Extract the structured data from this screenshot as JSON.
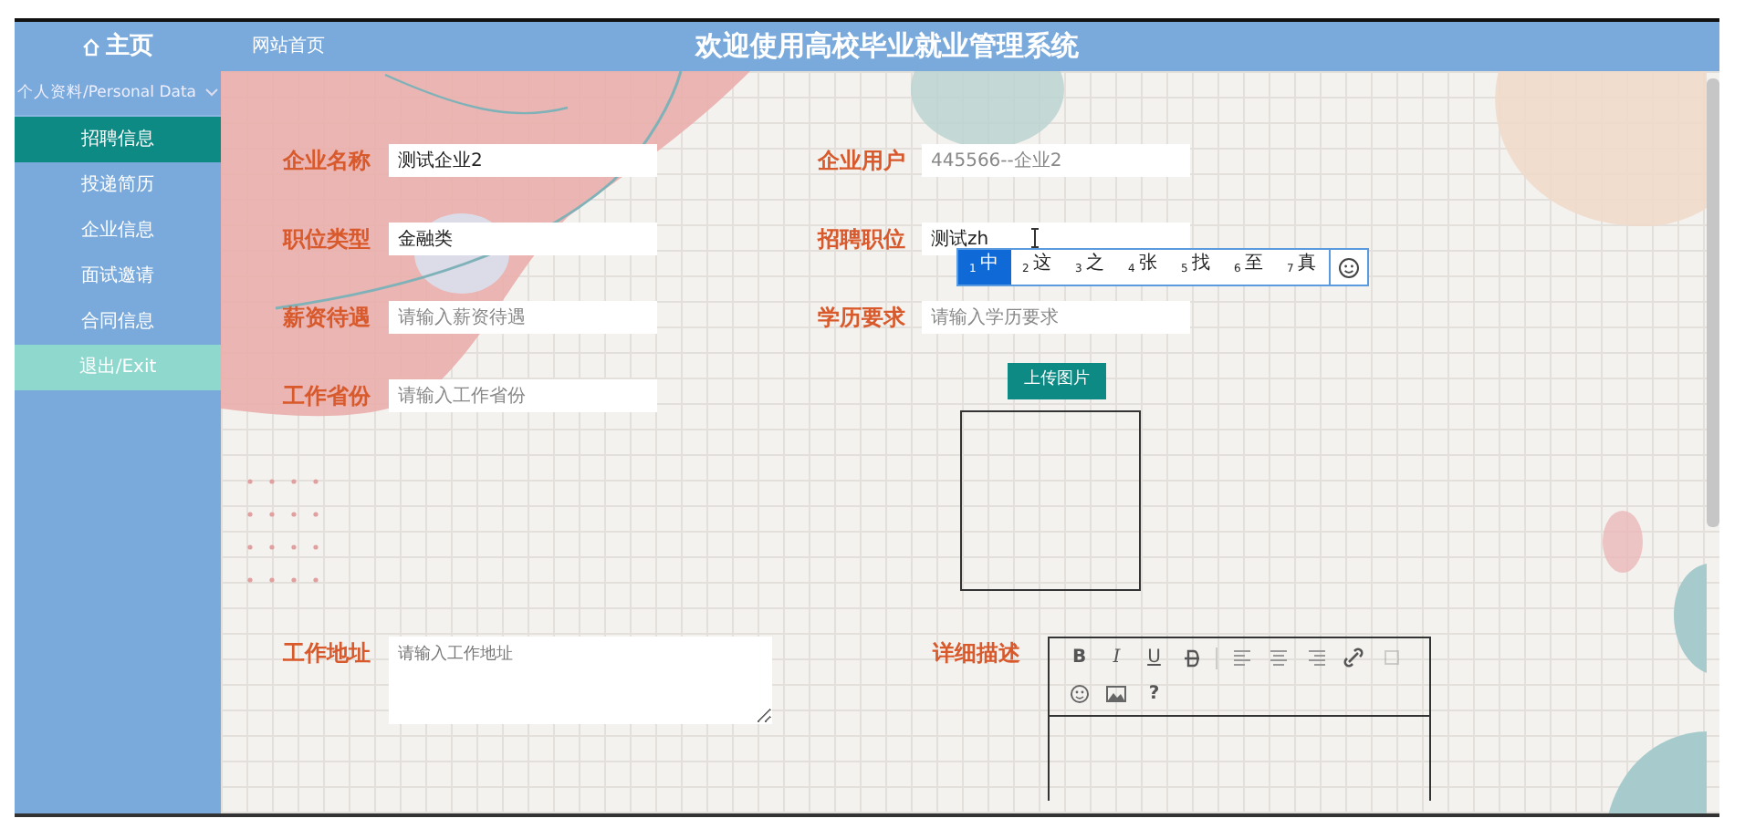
{
  "header": {
    "home": "主页",
    "site_link": "网站首页",
    "title": "欢迎使用高校毕业就业管理系统"
  },
  "sidebar": {
    "group": {
      "label": "个人资料/Personal Data",
      "expanded": true
    },
    "items": [
      {
        "label": "招聘信息",
        "selected": true,
        "kind": "link"
      },
      {
        "label": "投递简历",
        "selected": false,
        "kind": "link"
      },
      {
        "label": "企业信息",
        "selected": false,
        "kind": "link"
      },
      {
        "label": "面试邀请",
        "selected": false,
        "kind": "link"
      },
      {
        "label": "合同信息",
        "selected": false,
        "kind": "link"
      },
      {
        "label": "退出/Exit",
        "selected": false,
        "kind": "exit"
      }
    ]
  },
  "form": {
    "rows": [
      {
        "left": {
          "label": "企业名称",
          "value": "测试企业2"
        },
        "right": {
          "kind": "input",
          "label": "企业用户",
          "placeholder": "445566--企业2"
        }
      },
      {
        "left": {
          "label": "职位类型",
          "value": "金融类"
        },
        "right": {
          "kind": "input",
          "label": "招聘职位",
          "value": "测试zh"
        }
      },
      {
        "left": {
          "label": "薪资待遇",
          "placeholder": "请输入薪资待遇"
        },
        "right": {
          "kind": "input",
          "label": "学历要求",
          "placeholder": "请输入学历要求"
        }
      },
      {
        "left": {
          "label": "工作省份",
          "placeholder": "请输入工作省份"
        },
        "right": {
          "kind": "upload",
          "button": "上传图片"
        }
      }
    ],
    "address": {
      "label": "工作地址",
      "placeholder": "请输入工作地址"
    },
    "description": {
      "label": "详细描述",
      "toolbar": [
        {
          "kind": "bold",
          "label": "B",
          "disabled": false
        },
        {
          "kind": "italic",
          "label": "I",
          "disabled": false
        },
        {
          "kind": "underline",
          "label": "U",
          "disabled": false
        },
        {
          "kind": "strike",
          "disabled": false
        },
        {
          "kind": "align-left",
          "disabled": false
        },
        {
          "kind": "align-center",
          "disabled": false
        },
        {
          "kind": "align-right",
          "disabled": false
        },
        {
          "kind": "link",
          "disabled": false
        },
        {
          "kind": "unlink",
          "disabled": true
        },
        {
          "kind": "emoji",
          "disabled": false
        },
        {
          "kind": "image",
          "disabled": false
        },
        {
          "kind": "help",
          "label": "?",
          "disabled": false
        }
      ]
    }
  },
  "ime": {
    "candidates": [
      {
        "number": "1",
        "text": "中",
        "selected": true
      },
      {
        "number": "2",
        "text": "这",
        "selected": false
      },
      {
        "number": "3",
        "text": "之",
        "selected": false
      },
      {
        "number": "4",
        "text": "张",
        "selected": false
      },
      {
        "number": "5",
        "text": "找",
        "selected": false
      },
      {
        "number": "6",
        "text": "至",
        "selected": false
      },
      {
        "number": "7",
        "text": "真",
        "selected": false
      }
    ]
  }
}
